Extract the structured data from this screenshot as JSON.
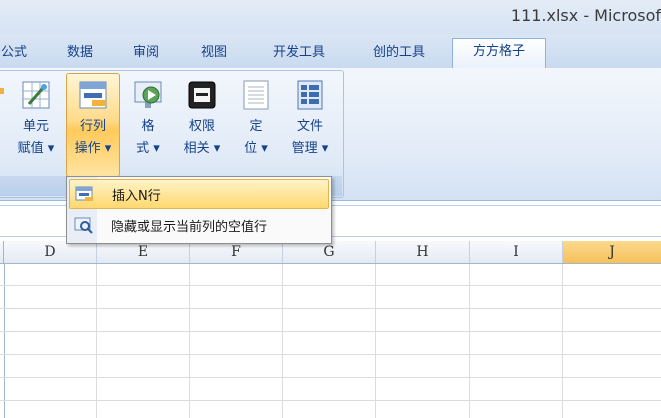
{
  "window": {
    "title": "111.xlsx - Microsof"
  },
  "tabs": [
    {
      "label": "公式"
    },
    {
      "label": "数据"
    },
    {
      "label": "审阅"
    },
    {
      "label": "视图"
    },
    {
      "label": "开发工具"
    },
    {
      "label": "创的工具"
    },
    {
      "label": "方方格子",
      "active": true
    }
  ],
  "ribbon": {
    "buttons": [
      {
        "line1": "单元",
        "line2": "赋值 ▾",
        "icon": "cell-assign-icon"
      },
      {
        "line1": "行列",
        "line2": "操作 ▾",
        "icon": "row-column-icon",
        "active": true
      },
      {
        "line1": "格",
        "line2": "式 ▾",
        "icon": "format-icon"
      },
      {
        "line1": "权限",
        "line2": "相关 ▾",
        "icon": "permission-icon"
      },
      {
        "line1": "定",
        "line2": "位 ▾",
        "icon": "locate-icon"
      },
      {
        "line1": "文件",
        "line2": "管理 ▾",
        "icon": "file-manage-icon"
      }
    ]
  },
  "dropdown": {
    "items": [
      {
        "label": "插入N行",
        "icon": "insert-rows-icon",
        "highlighted": true
      },
      {
        "label": "隐藏或显示当前列的空值行",
        "icon": "hide-show-icon"
      }
    ]
  },
  "sheet": {
    "columns": [
      "D",
      "E",
      "F",
      "G",
      "H",
      "I",
      "J"
    ],
    "selected_column": "J"
  },
  "colors": {
    "accent": "#ffd870",
    "tab_text": "#15428b",
    "selected_header": "#f6c05b"
  }
}
